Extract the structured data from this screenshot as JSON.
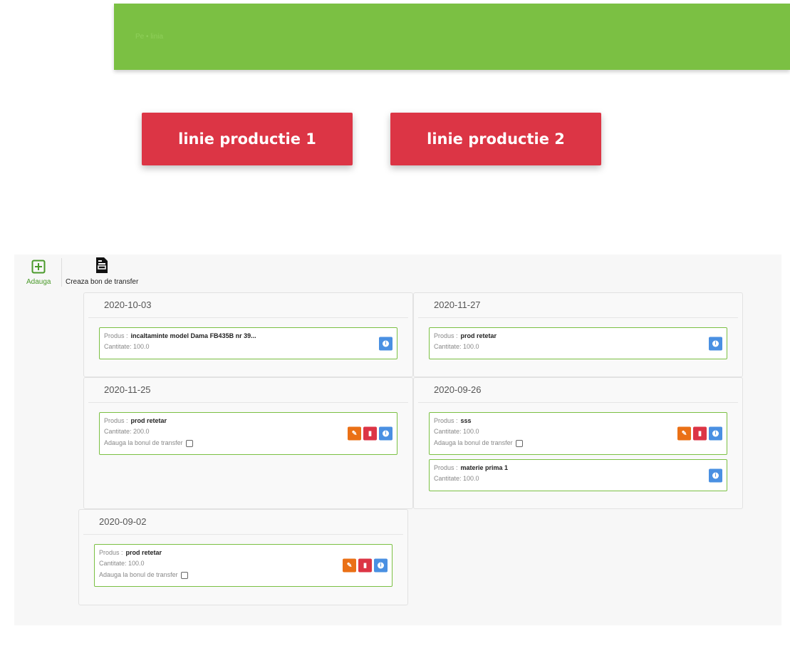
{
  "header": {
    "breadcrumb": "Pe • linia"
  },
  "lines": [
    {
      "label": "linie productie 1"
    },
    {
      "label": "linie productie 2"
    }
  ],
  "toolbar": {
    "add_label": "Adauga",
    "transfer_label": "Creaza bon de transfer"
  },
  "labels": {
    "product": "Produs :",
    "quantity_prefix": "Cantitate: ",
    "add_to_transfer": "Adauga la bonul de transfer"
  },
  "cards": [
    {
      "date": "2020-10-03",
      "items": [
        {
          "product": "incaltaminte model Dama FB435B nr 39...",
          "quantity": "100.0"
        }
      ]
    },
    {
      "date": "2020-11-27",
      "items": [
        {
          "product": "prod retetar",
          "quantity": "100.0"
        }
      ]
    },
    {
      "date": "2020-11-25",
      "items": [
        {
          "product": "prod retetar",
          "quantity": "200.0"
        }
      ]
    },
    {
      "date": "2020-09-26",
      "items": [
        {
          "product": "sss",
          "quantity": "100.0"
        },
        {
          "product": "materie prima 1",
          "quantity": "100.0"
        }
      ]
    },
    {
      "date": "2020-09-02",
      "items": [
        {
          "product": "prod retetar",
          "quantity": "100.0"
        }
      ]
    }
  ],
  "colors": {
    "header_bg": "#7bc043",
    "line_button": "#dc3545",
    "item_border": "#7bc043",
    "info": "#4a90e2",
    "edit": "#ea7016",
    "delete": "#dc3545"
  }
}
